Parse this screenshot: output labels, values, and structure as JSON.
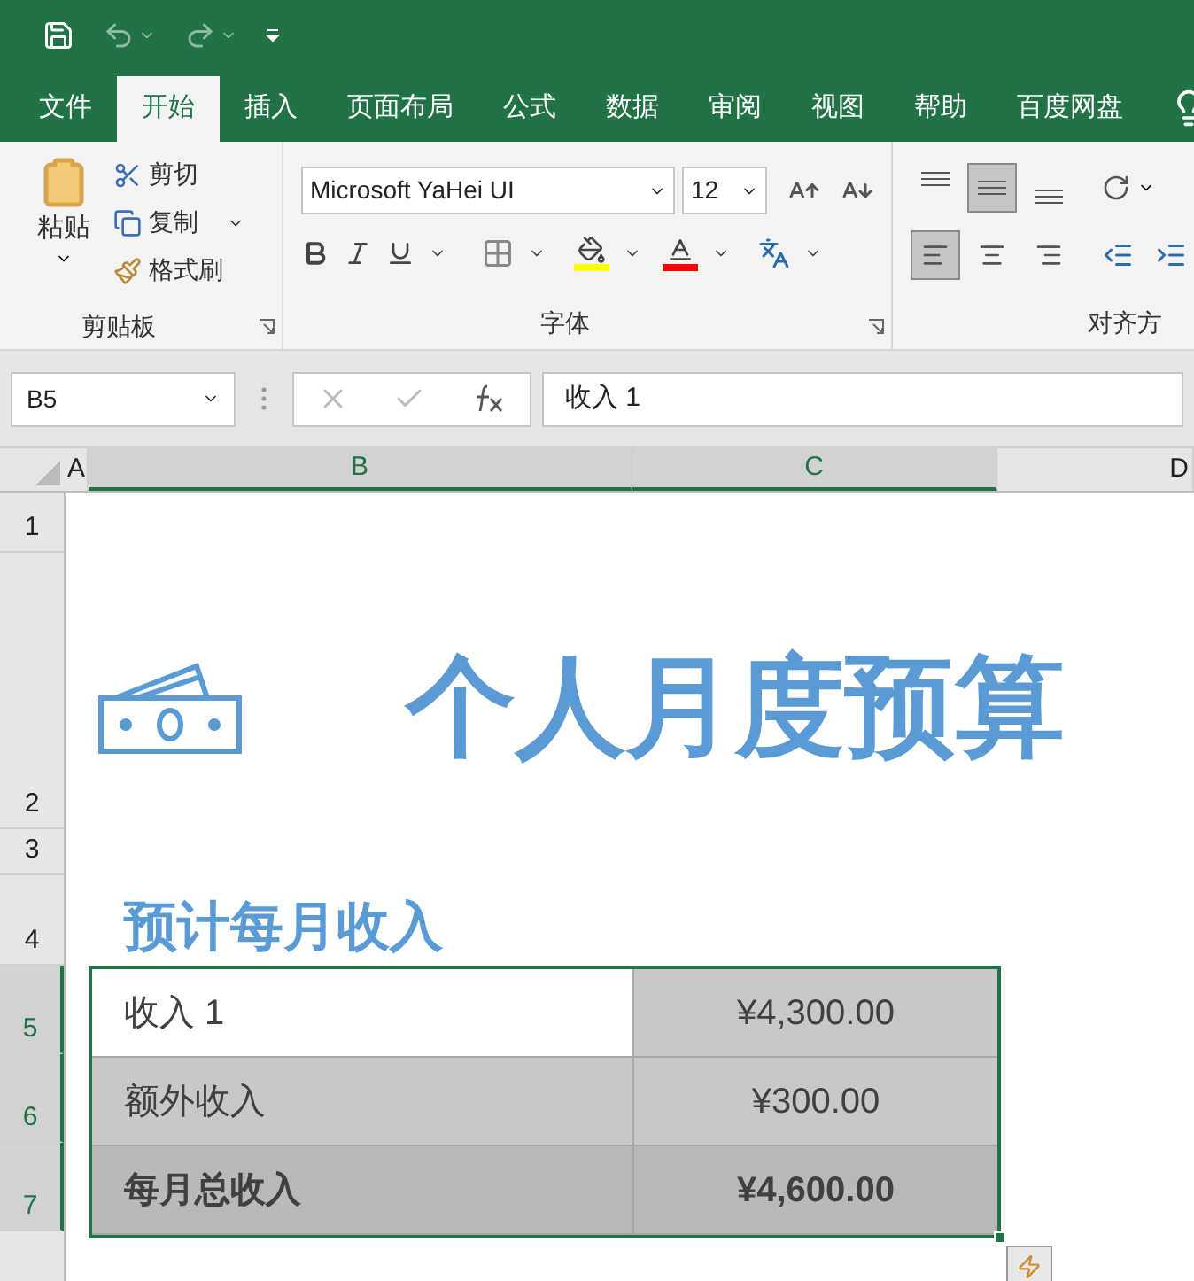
{
  "ribbon_tabs": [
    {
      "label": "文件",
      "selected": false
    },
    {
      "label": "开始",
      "selected": true
    },
    {
      "label": "插入",
      "selected": false
    },
    {
      "label": "页面布局",
      "selected": false
    },
    {
      "label": "公式",
      "selected": false
    },
    {
      "label": "数据",
      "selected": false
    },
    {
      "label": "审阅",
      "selected": false
    },
    {
      "label": "视图",
      "selected": false
    },
    {
      "label": "帮助",
      "selected": false
    },
    {
      "label": "百度网盘",
      "selected": false
    }
  ],
  "clipboard": {
    "paste": "粘贴",
    "cut": "剪切",
    "copy": "复制",
    "format_painter": "格式刷",
    "group_label": "剪贴板"
  },
  "font": {
    "name": "Microsoft YaHei UI",
    "size": "12",
    "group_label": "字体"
  },
  "alignment": {
    "group_label": "对齐方",
    "vertical": [
      {
        "kind": "top",
        "selected": false
      },
      {
        "kind": "middle",
        "selected": true
      },
      {
        "kind": "bottom",
        "selected": false
      }
    ],
    "horizontal": [
      {
        "kind": "left",
        "selected": true
      },
      {
        "kind": "center",
        "selected": false
      },
      {
        "kind": "right",
        "selected": false
      }
    ]
  },
  "formula_bar": {
    "name_box": "B5",
    "formula": "收入 1"
  },
  "columns": [
    {
      "label": "A",
      "selected": false
    },
    {
      "label": "B",
      "selected": true
    },
    {
      "label": "C",
      "selected": true
    },
    {
      "label": "D",
      "selected": false
    }
  ],
  "row_headers": [
    {
      "label": "1",
      "selected": false
    },
    {
      "label": "2",
      "selected": false
    },
    {
      "label": "3",
      "selected": false
    },
    {
      "label": "4",
      "selected": false
    },
    {
      "label": "5",
      "selected": true
    },
    {
      "label": "6",
      "selected": true
    },
    {
      "label": "7",
      "selected": true
    }
  ],
  "sheet": {
    "title": "个人月度预算",
    "section_heading": "预计每月收入",
    "rows": [
      {
        "kind": "item",
        "label": "收入 1",
        "amount": "¥4,300.00",
        "active": true
      },
      {
        "kind": "item",
        "label": "额外收入",
        "amount": "¥300.00",
        "active": false
      },
      {
        "kind": "total",
        "label": "每月总收入",
        "amount": "¥4,600.00",
        "active": false
      }
    ]
  }
}
